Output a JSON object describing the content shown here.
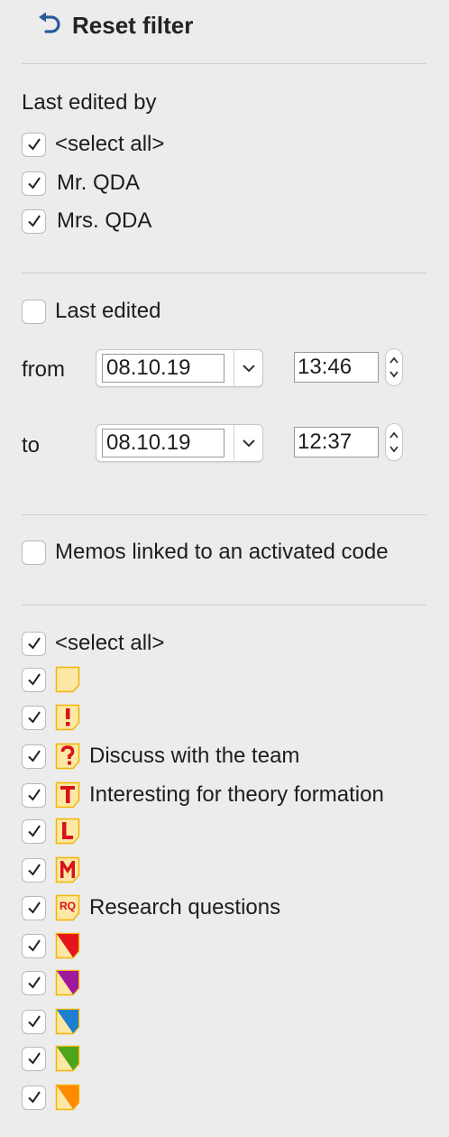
{
  "reset": {
    "label": "Reset filter",
    "icon": "undo-arrow-icon"
  },
  "last_edited_by": {
    "heading": "Last edited by",
    "items": [
      {
        "label": "<select all>",
        "checked": true
      },
      {
        "label": "Mr. QDA",
        "checked": true
      },
      {
        "label": "Mrs. QDA",
        "checked": true
      }
    ]
  },
  "last_edited": {
    "label": "Last edited",
    "checked": false,
    "from_label": "from",
    "from_date": "08.10.19",
    "from_time": "13:46",
    "to_label": "to",
    "to_date": "08.10.19",
    "to_time": "12:37"
  },
  "activated_code": {
    "label": "Memos linked to an activated code",
    "checked": false
  },
  "memo_types": {
    "select_all": "<select all>",
    "items": [
      {
        "icon": "memo-blank-icon",
        "label": ""
      },
      {
        "icon": "memo-exclamation-icon",
        "glyph": "!",
        "label": ""
      },
      {
        "icon": "memo-question-icon",
        "glyph": "?",
        "label": "Discuss with the team"
      },
      {
        "icon": "memo-t-icon",
        "glyph": "T",
        "label": "Interesting for theory formation"
      },
      {
        "icon": "memo-l-icon",
        "glyph": "L",
        "label": ""
      },
      {
        "icon": "memo-m-icon",
        "glyph": "M",
        "label": ""
      },
      {
        "icon": "memo-rq-icon",
        "glyph": "RQ",
        "label": "Research questions"
      },
      {
        "icon": "memo-red-icon",
        "color": "#e5141c",
        "label": ""
      },
      {
        "icon": "memo-purple-icon",
        "color": "#a0199b",
        "label": ""
      },
      {
        "icon": "memo-blue-icon",
        "color": "#1e7fcf",
        "label": ""
      },
      {
        "icon": "memo-green-icon",
        "color": "#4fa51a",
        "label": ""
      },
      {
        "icon": "memo-orange-icon",
        "color": "#ff8a00",
        "label": ""
      }
    ]
  },
  "colors": {
    "memo_fill": "#fde7a4",
    "memo_border": "#f2b600",
    "glyph": "#d8121a",
    "reset_icon": "#2a5b9a"
  }
}
